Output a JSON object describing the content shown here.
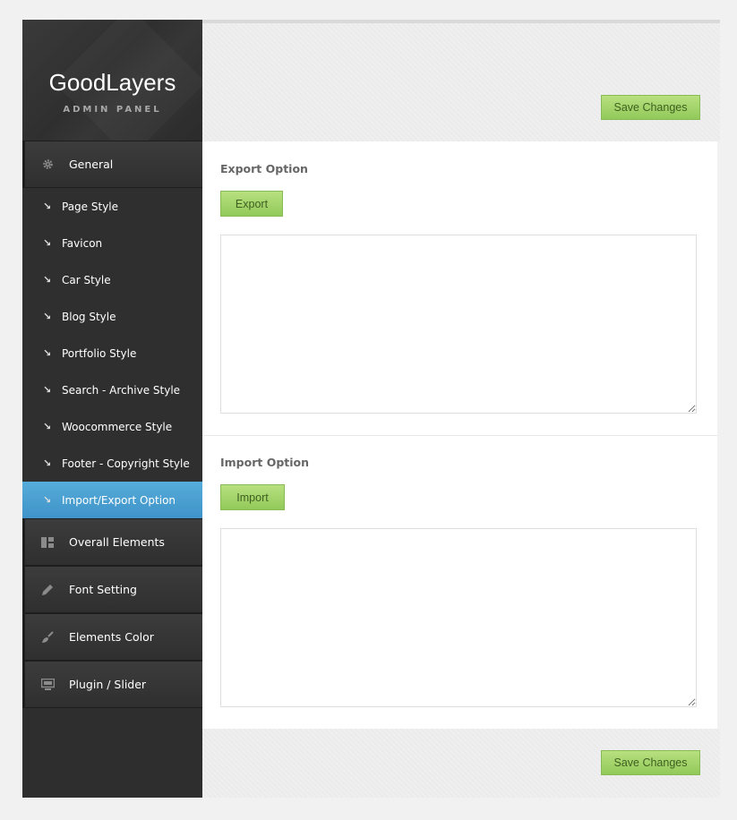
{
  "brand": {
    "title": "GoodLayers",
    "subtitle": "ADMIN PANEL"
  },
  "sidebar": {
    "general": {
      "label": "General",
      "icon": "gear-icon"
    },
    "sub_items": [
      {
        "label": "Page Style"
      },
      {
        "label": "Favicon"
      },
      {
        "label": "Car Style"
      },
      {
        "label": "Blog Style"
      },
      {
        "label": "Portfolio Style"
      },
      {
        "label": "Search - Archive Style"
      },
      {
        "label": "Woocommerce Style"
      },
      {
        "label": "Footer - Copyright Style"
      },
      {
        "label": "Import/Export Option",
        "active": true
      }
    ],
    "sections": [
      {
        "label": "Overall Elements",
        "icon": "layout-icon"
      },
      {
        "label": "Font Setting",
        "icon": "pencil-icon"
      },
      {
        "label": "Elements Color",
        "icon": "brush-icon"
      },
      {
        "label": "Plugin / Slider",
        "icon": "monitor-icon"
      }
    ]
  },
  "toolbar": {
    "save_label": "Save Changes"
  },
  "export_section": {
    "title": "Export Option",
    "button": "Export",
    "textarea_value": ""
  },
  "import_section": {
    "title": "Import Option",
    "button": "Import",
    "textarea_value": ""
  },
  "colors": {
    "accent_blue": "#4a9fd2",
    "button_green": "#a5d46d",
    "sidebar_dark": "#2e2e2e"
  }
}
